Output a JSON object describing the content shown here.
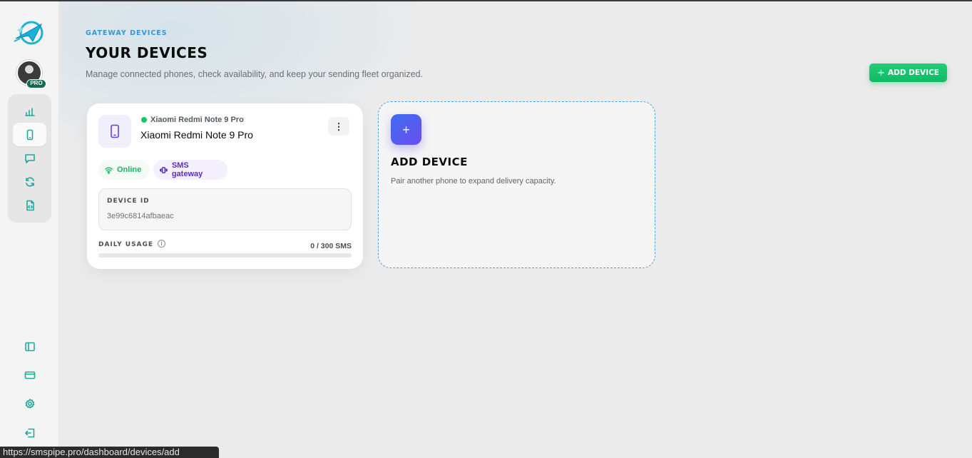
{
  "header": {
    "eyebrow": "GATEWAY DEVICES",
    "title": "YOUR DEVICES",
    "subtitle": "Manage connected phones, check availability, and keep your sending fleet organized.",
    "add_button_label": "ADD DEVICE",
    "add_button_icon": "plus-icon"
  },
  "sidebar": {
    "logo": "app-logo",
    "badge": "PRO",
    "nav_items": [
      {
        "icon": "chart-bars-icon",
        "active": false
      },
      {
        "icon": "smartphone-icon",
        "active": true
      },
      {
        "icon": "message-icon",
        "active": false
      },
      {
        "icon": "refresh-icon",
        "active": false
      },
      {
        "icon": "file-code-icon",
        "active": false
      }
    ],
    "bottom_items": [
      {
        "icon": "panel-left-icon"
      },
      {
        "icon": "credit-card-icon"
      },
      {
        "icon": "settings-icon"
      },
      {
        "icon": "logout-icon"
      }
    ]
  },
  "device": {
    "model_label": "Xiaomi Redmi Note 9 Pro",
    "name": "Xiaomi Redmi Note 9 Pro",
    "status": "Online",
    "type": "SMS gateway",
    "id_label": "DEVICE ID",
    "id_value": "3e99c6814afbaeac",
    "usage_label": "DAILY USAGE",
    "usage_value": "0 / 300 SMS",
    "usage_fraction": 0,
    "menu_icon": "more-vertical-icon"
  },
  "add_card": {
    "icon_text": "+",
    "title": "ADD DEVICE",
    "description": "Pair another phone to expand delivery capacity."
  },
  "status_bar": {
    "url": "https://smspipe.pro/dashboard/devices/add"
  },
  "colors": {
    "accent_green": "#18c964",
    "accent_blue": "#2d9ad8",
    "accent_purple": "#5a2ec6",
    "sidebar_icon": "#1fa99a"
  }
}
